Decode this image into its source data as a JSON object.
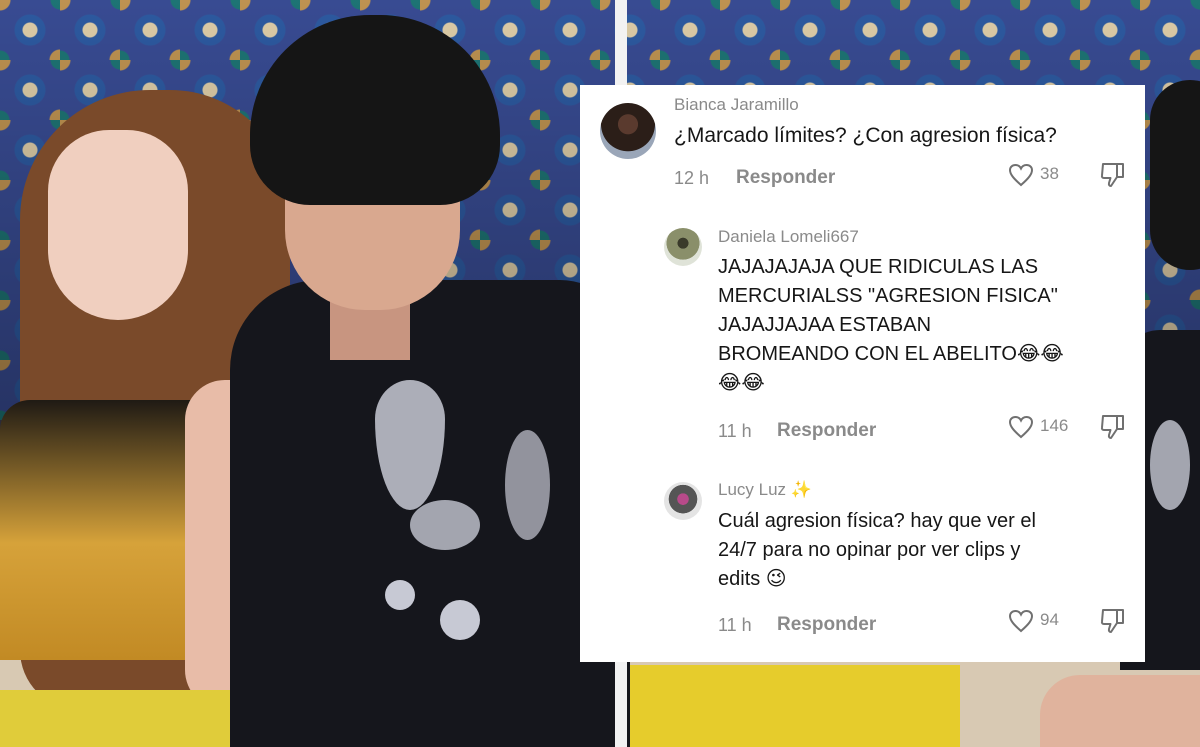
{
  "comments": [
    {
      "username": "Bianca Jaramillo",
      "text": "¿Marcado límites? ¿Con agresion física?",
      "time": "12 h",
      "reply_label": "Responder",
      "likes": "38"
    },
    {
      "username": "Daniela Lomeli667",
      "text_lines": [
        "JAJAJAJAJA QUE RIDICULAS LAS",
        "MERCURIALSS \"AGRESION FISICA\"",
        "JAJAJJAJAA ESTABAN",
        "BROMEANDO CON EL ABELITO😂😂",
        "😂😂"
      ],
      "time": "11 h",
      "reply_label": "Responder",
      "likes": "146"
    },
    {
      "username": "Lucy Luz ✨",
      "text_lines": [
        "Cuál agresion física? hay que ver el",
        "24/7 para no opinar por ver clips y",
        "edits 😉"
      ],
      "time": "11 h",
      "reply_label": "Responder",
      "likes": "94"
    }
  ],
  "icons": {
    "like": "heart-icon",
    "dislike": "thumbs-down-icon"
  },
  "colors": {
    "card_bg": "#ffffff",
    "text": "#161616",
    "muted": "#8a8a8a"
  }
}
